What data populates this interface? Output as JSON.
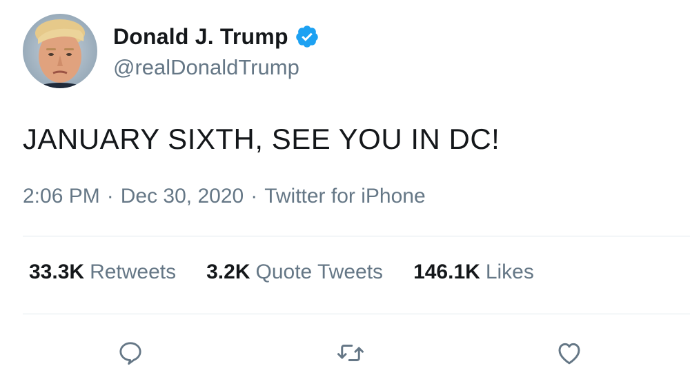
{
  "author": {
    "display_name": "Donald J. Trump",
    "handle": "@realDonaldTrump",
    "verified": true,
    "verified_icon": "verified-badge-icon",
    "avatar_alt": "avatar"
  },
  "tweet": {
    "text": "JANUARY SIXTH, SEE YOU IN DC!",
    "time": "2:06 PM",
    "date": "Dec 30, 2020",
    "source": "Twitter for iPhone",
    "separator": "·"
  },
  "stats": {
    "retweets_count": "33.3K",
    "retweets_label": "Retweets",
    "quotes_count": "3.2K",
    "quotes_label": "Quote Tweets",
    "likes_count": "146.1K",
    "likes_label": "Likes"
  },
  "actions": {
    "reply_icon": "reply-icon",
    "retweet_icon": "retweet-icon",
    "like_icon": "heart-icon"
  },
  "colors": {
    "text_primary": "#14171a",
    "text_secondary": "#657786",
    "verified_blue": "#1da1f2",
    "divider": "#e1e8ed"
  }
}
